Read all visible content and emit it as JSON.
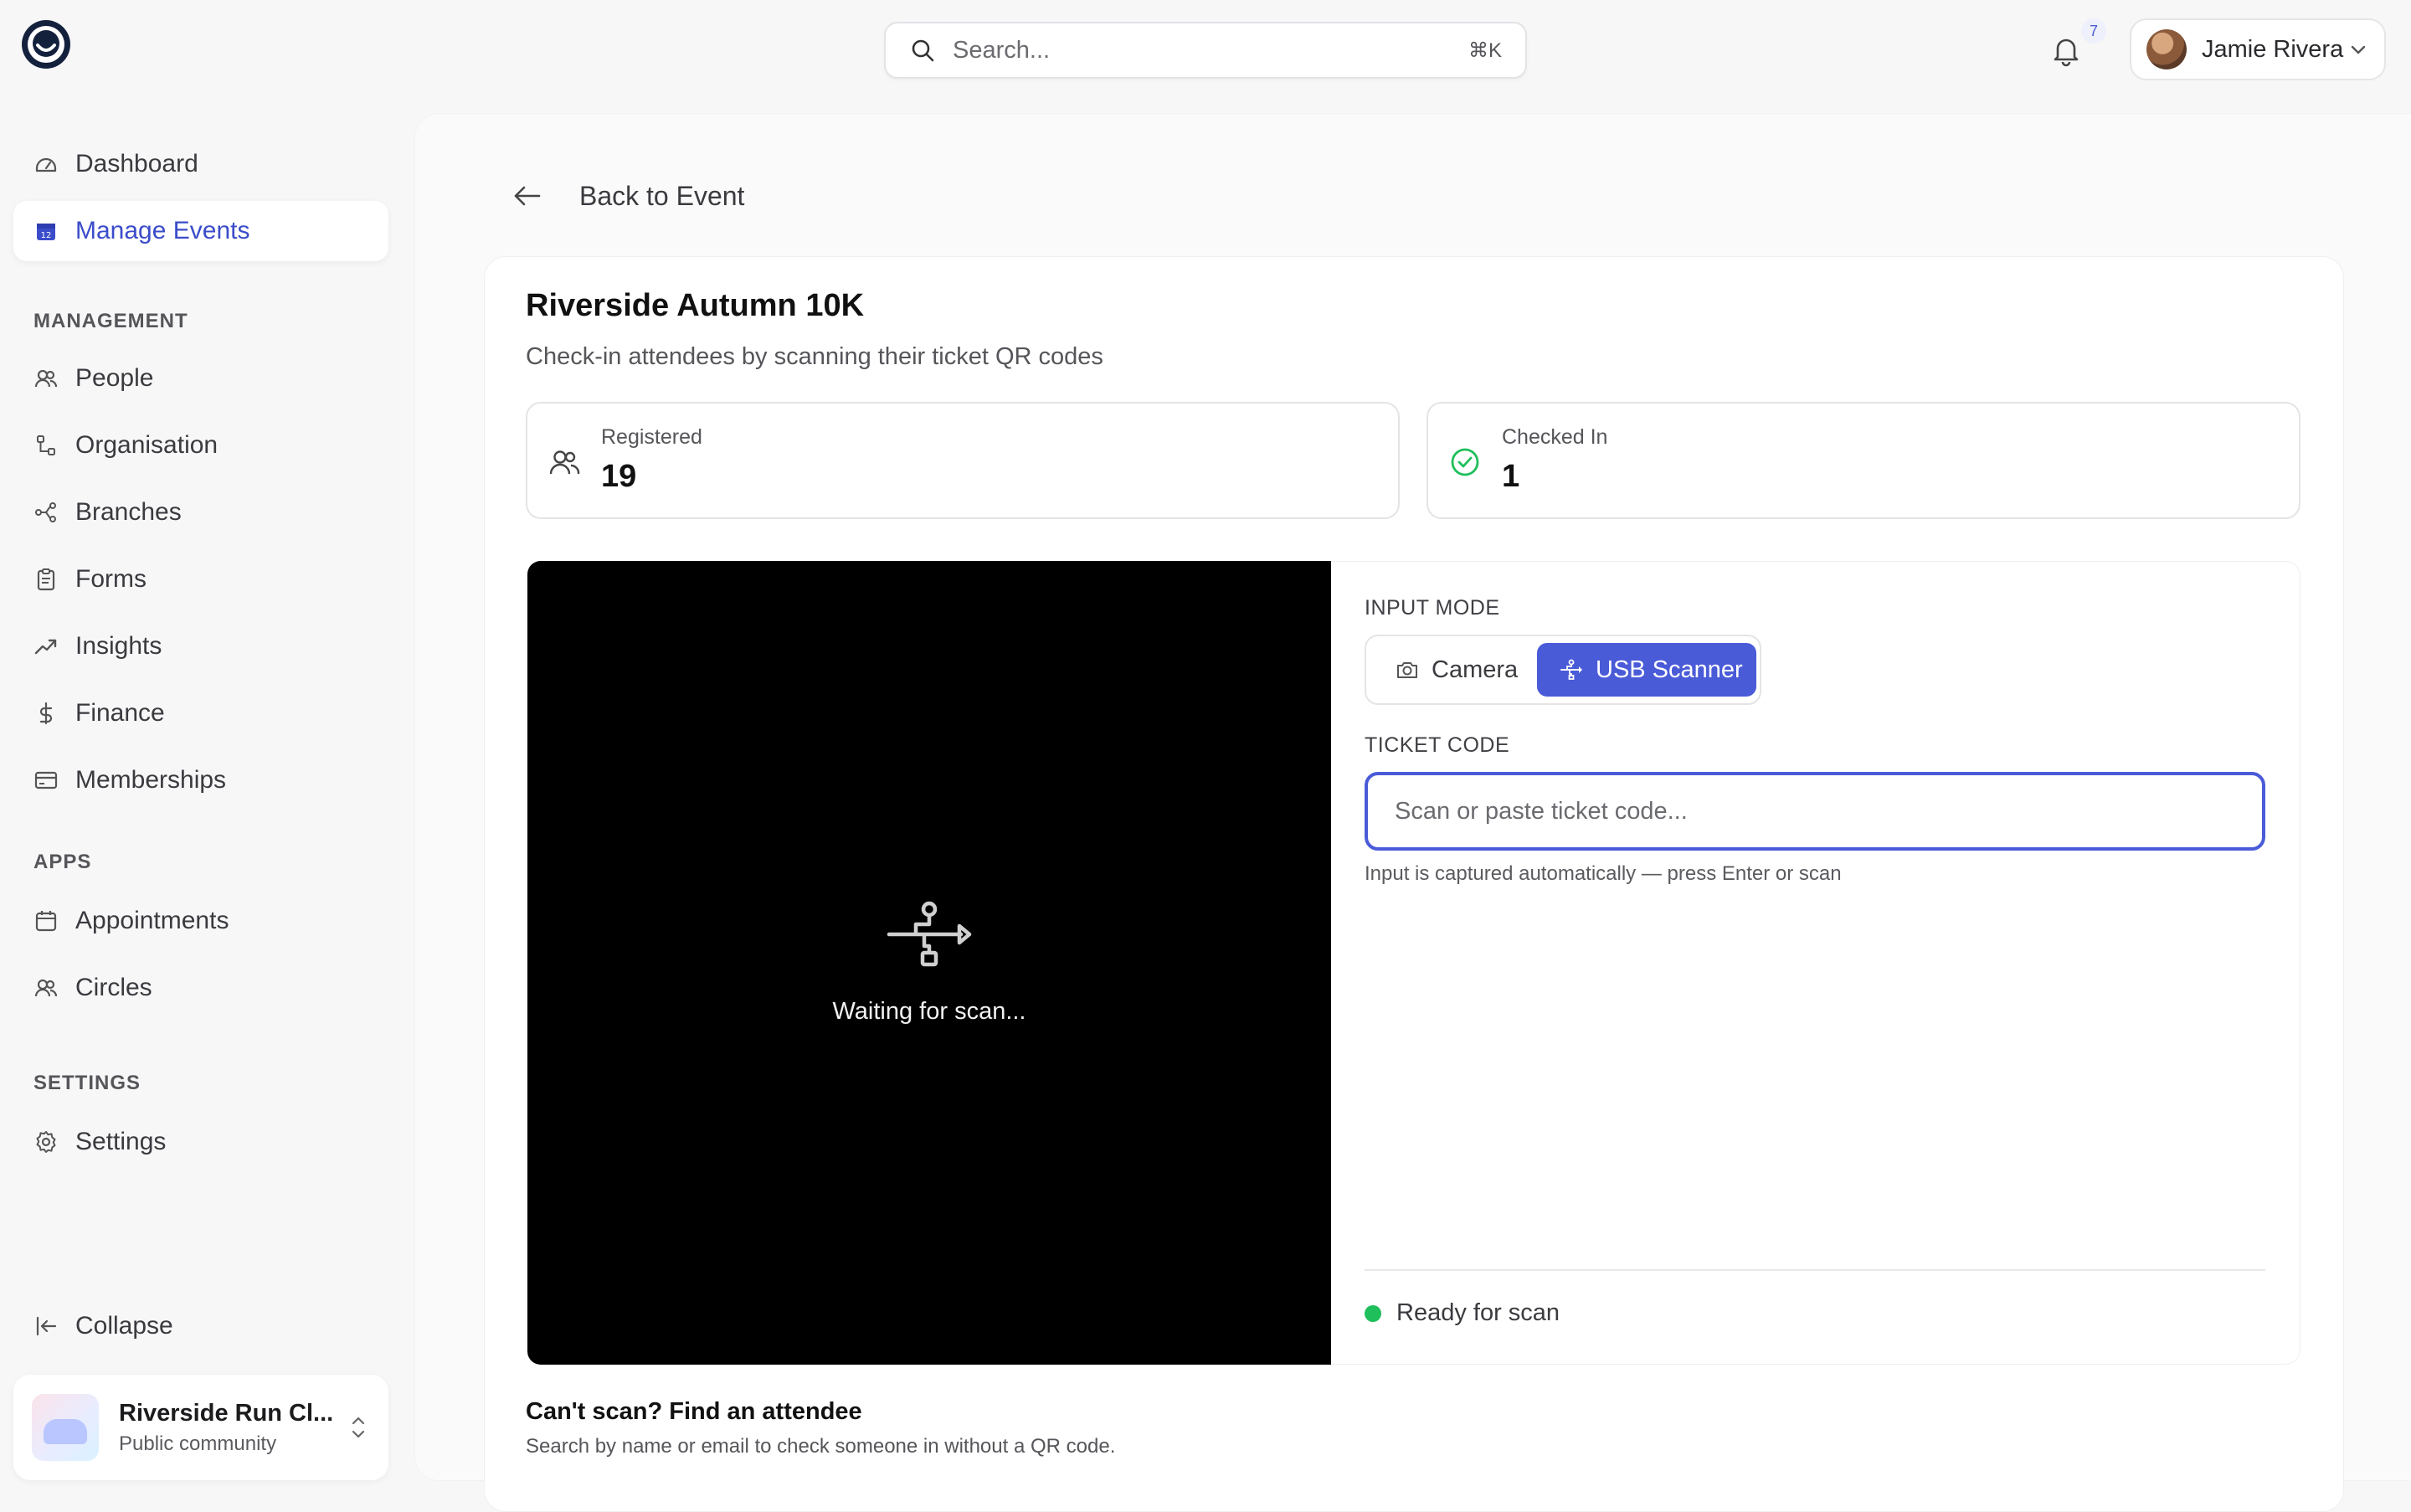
{
  "header": {
    "search_placeholder": "Search...",
    "search_shortcut": "⌘K",
    "notification_count": "7",
    "user_name": "Jamie Rivera"
  },
  "sidebar": {
    "items": [
      {
        "label": "Dashboard",
        "icon": "gauge-icon"
      },
      {
        "label": "Manage Events",
        "icon": "calendar-icon",
        "active": true
      }
    ],
    "management_heading": "MANAGEMENT",
    "management": [
      {
        "label": "People",
        "icon": "people-icon"
      },
      {
        "label": "Organisation",
        "icon": "org-tree-icon"
      },
      {
        "label": "Branches",
        "icon": "branches-icon"
      },
      {
        "label": "Forms",
        "icon": "clipboard-icon"
      },
      {
        "label": "Insights",
        "icon": "trend-icon"
      },
      {
        "label": "Finance",
        "icon": "dollar-icon"
      },
      {
        "label": "Memberships",
        "icon": "card-icon"
      }
    ],
    "apps_heading": "APPS",
    "apps": [
      {
        "label": "Appointments",
        "icon": "calendar-icon"
      },
      {
        "label": "Circles",
        "icon": "people-icon"
      }
    ],
    "settings_heading": "SETTINGS",
    "settings": [
      {
        "label": "Settings",
        "icon": "gear-icon"
      }
    ],
    "collapse_label": "Collapse",
    "org": {
      "name": "Riverside Run Cl...",
      "subtitle": "Public community"
    }
  },
  "main": {
    "back_label": "Back to Event",
    "event_title": "Riverside Autumn 10K",
    "event_subtitle": "Check-in attendees by scanning their ticket QR codes",
    "stats": [
      {
        "label": "Registered",
        "value": "19",
        "icon": "people-icon"
      },
      {
        "label": "Checked In",
        "value": "1",
        "icon": "check-circle-icon"
      }
    ],
    "scanner": {
      "waiting_text": "Waiting for scan...",
      "input_mode_label": "INPUT MODE",
      "modes": [
        {
          "label": "Camera",
          "icon": "camera-icon",
          "selected": false
        },
        {
          "label": "USB Scanner",
          "icon": "usb-icon",
          "selected": true
        }
      ],
      "ticket_code_label": "TICKET CODE",
      "ticket_placeholder": "Scan or paste ticket code...",
      "ticket_value": "",
      "hint": "Input is captured automatically — press Enter or scan",
      "status": "Ready for scan",
      "status_color": "#1fbf5b"
    },
    "find": {
      "title": "Can't scan? Find an attendee",
      "subtitle": "Search by name or email to check someone in without a QR code."
    }
  },
  "colors": {
    "accent": "#4a5bd8",
    "active_nav_text": "#3b4cca",
    "success": "#1fbf5b"
  }
}
